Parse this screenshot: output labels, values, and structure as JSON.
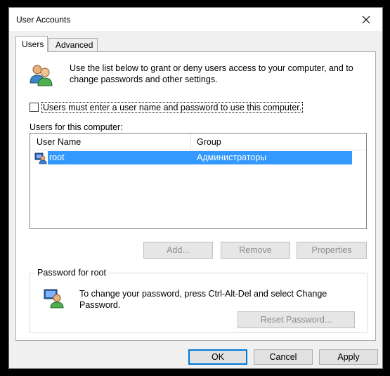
{
  "window": {
    "title": "User Accounts"
  },
  "tabs": [
    {
      "label": "Users",
      "active": true
    },
    {
      "label": "Advanced",
      "active": false
    }
  ],
  "intro": {
    "text": "Use the list below to grant or deny users access to your computer, and to change passwords and other settings."
  },
  "checkbox": {
    "label": "Users must enter a user name and password to use this computer.",
    "checked": false
  },
  "users_list": {
    "label": "Users for this computer:",
    "columns": [
      "User Name",
      "Group"
    ],
    "rows": [
      {
        "user_name": "root",
        "group": "Администраторы",
        "selected": true
      }
    ]
  },
  "list_buttons": {
    "add": "Add...",
    "remove": "Remove",
    "properties": "Properties"
  },
  "password_group": {
    "title": "Password for root",
    "text": "To change your password, press Ctrl-Alt-Del and select Change Password.",
    "reset_button": "Reset Password..."
  },
  "dialog_buttons": {
    "ok": "OK",
    "cancel": "Cancel",
    "apply": "Apply"
  },
  "colors": {
    "selection": "#3399ff",
    "default_button_border": "#0078d7",
    "disabled_text": "#8d8d8d"
  }
}
